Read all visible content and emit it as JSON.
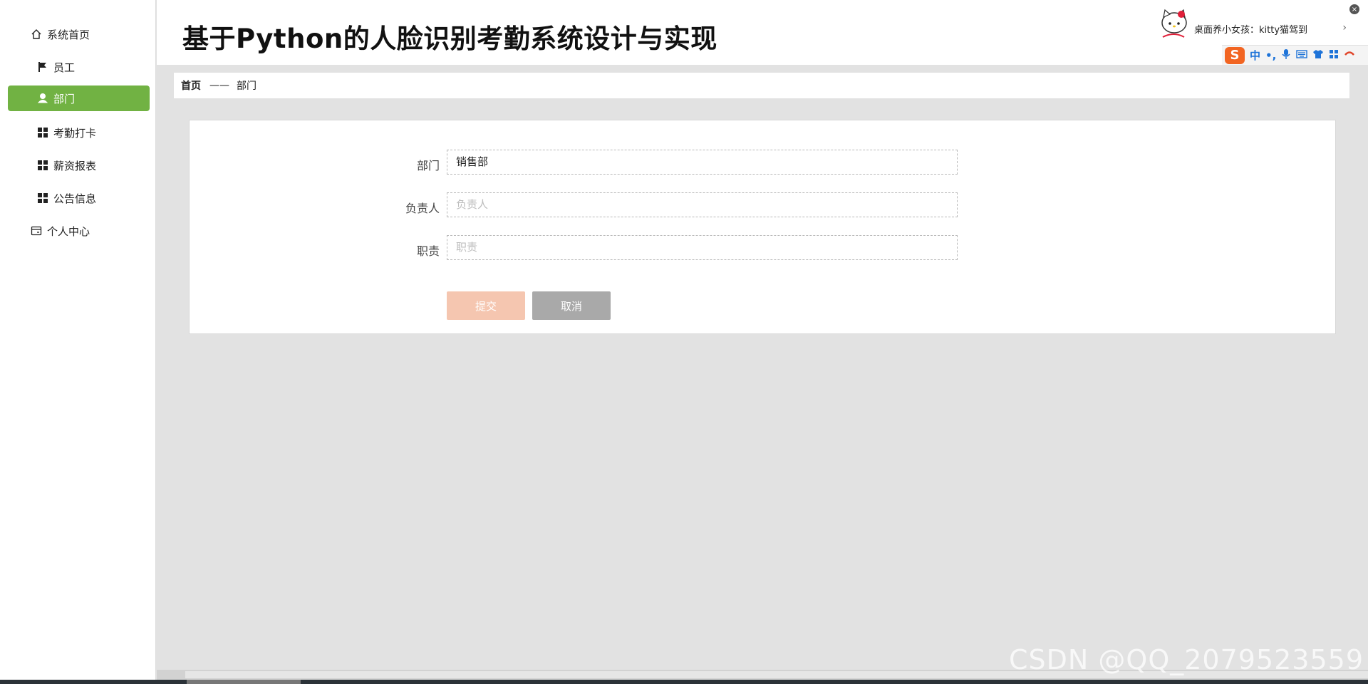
{
  "app": {
    "title": "基于Python的人脸识别考勤系统设计与实现"
  },
  "sidebar": {
    "items": [
      {
        "label": "系统首页",
        "icon": "home-icon"
      },
      {
        "label": "员工",
        "icon": "flag-icon"
      },
      {
        "label": "部门",
        "icon": "user-icon",
        "active": true
      },
      {
        "label": "考勤打卡",
        "icon": "grid-icon"
      },
      {
        "label": "薪资报表",
        "icon": "grid-icon"
      },
      {
        "label": "公告信息",
        "icon": "grid-icon"
      },
      {
        "label": "个人中心",
        "icon": "card-icon"
      }
    ],
    "active_color": "#71b243"
  },
  "breadcrumb": {
    "home": "首页",
    "separator": "——",
    "current": "部门"
  },
  "form": {
    "department": {
      "label": "部门",
      "value": "销售部"
    },
    "manager": {
      "label": "负责人",
      "placeholder": "负责人"
    },
    "duty": {
      "label": "职责",
      "placeholder": "职责"
    },
    "submit_label": "提交",
    "cancel_label": "取消",
    "submit_color": "#f5c6b0",
    "cancel_color": "#a9a9a9"
  },
  "notification": {
    "text": "桌面养小女孩：kitty猫驾到",
    "chevron": "›",
    "close": "×"
  },
  "ime": {
    "logo": "S",
    "mode": "中",
    "punct": "•,"
  },
  "watermark": "CSDN @QQ_2079523559"
}
